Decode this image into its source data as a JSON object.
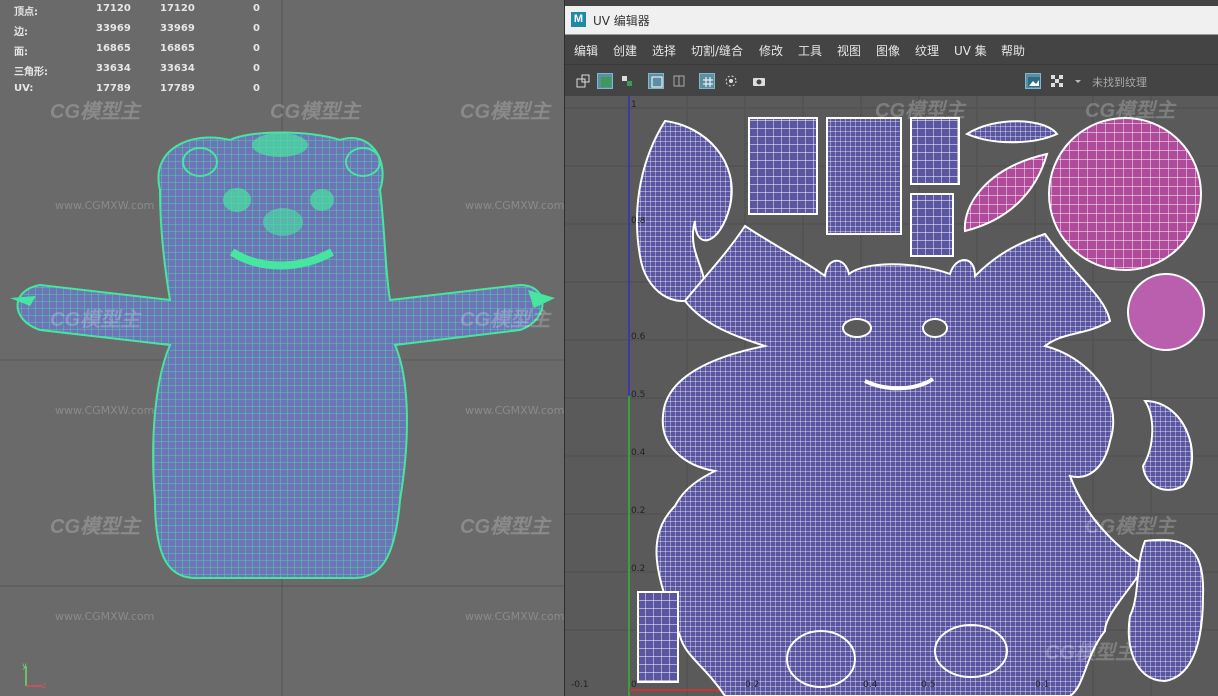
{
  "viewport": {
    "stats": [
      {
        "label": "顶点:",
        "v1": "17120",
        "v2": "17120",
        "v3": "0"
      },
      {
        "label": "边:",
        "v1": "33969",
        "v2": "33969",
        "v3": "0"
      },
      {
        "label": "面:",
        "v1": "16865",
        "v2": "16865",
        "v3": "0"
      },
      {
        "label": "三角形:",
        "v1": "33634",
        "v2": "33634",
        "v3": "0"
      },
      {
        "label": "UV:",
        "v1": "17789",
        "v2": "17789",
        "v3": "0"
      }
    ],
    "wireframe_color": "#46e6a0"
  },
  "uv_editor": {
    "logo": "M",
    "title": "UV 编辑器",
    "menu": [
      "编辑",
      "创建",
      "选择",
      "切割/缝合",
      "修改",
      "工具",
      "视图",
      "图像",
      "纹理",
      "UV 集",
      "帮助"
    ],
    "texture_status": "未找到纹理",
    "ruler_v": [
      "1",
      "0.8",
      "0.6",
      "0.5",
      "0.4",
      "0.2",
      "0.2"
    ],
    "ruler_u": [
      "-0.1",
      "0",
      "0.2",
      "0.4",
      "0.5",
      "0.1"
    ],
    "shell_fill": "#5a55a0",
    "shell_highlight": "#c03a9a"
  },
  "watermarks": {
    "brand": "CG模型主",
    "url": "www.CGMXW.com"
  }
}
